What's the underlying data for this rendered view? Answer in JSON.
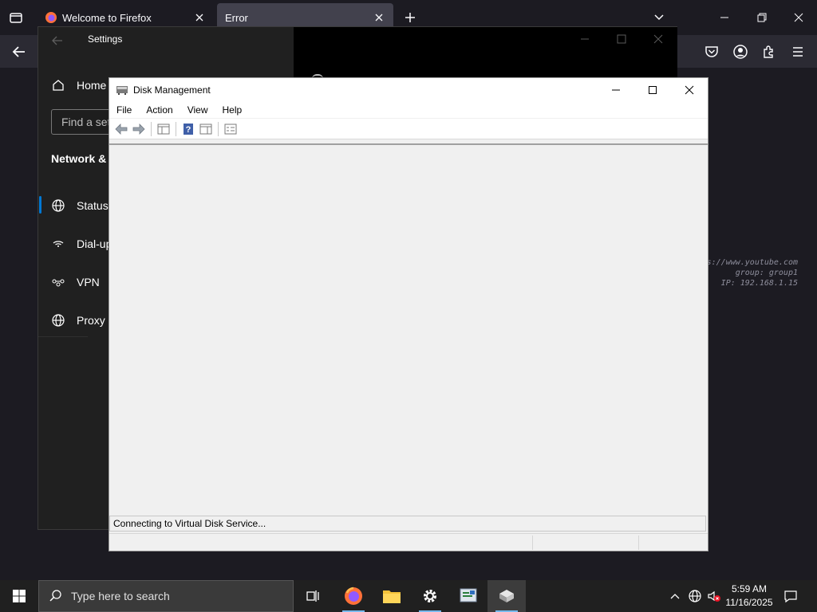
{
  "firefox": {
    "tabs": [
      {
        "label": "Welcome to Firefox",
        "active": false
      },
      {
        "label": "Error",
        "active": true
      }
    ],
    "watermark": {
      "line1": "s://www.youtube.com",
      "line2": "group: group1",
      "line3": "IP: 192.168.1.15"
    }
  },
  "settings": {
    "title": "Settings",
    "nav": {
      "home": "Home",
      "search_placeholder": "Find a set",
      "section": "Network &",
      "items": [
        "Status",
        "Dial-up",
        "VPN",
        "Proxy"
      ]
    }
  },
  "disk_management": {
    "title": "Disk Management",
    "menu": [
      "File",
      "Action",
      "View",
      "Help"
    ],
    "status_text": "Connecting to Virtual Disk Service..."
  },
  "taskbar": {
    "search_placeholder": "Type here to search",
    "time": "5:59 AM",
    "date": "11/16/2025"
  },
  "colors": {
    "accent": "#0078d4",
    "firefox_bg": "#1c1b22",
    "taskbar_bg": "#202020"
  }
}
